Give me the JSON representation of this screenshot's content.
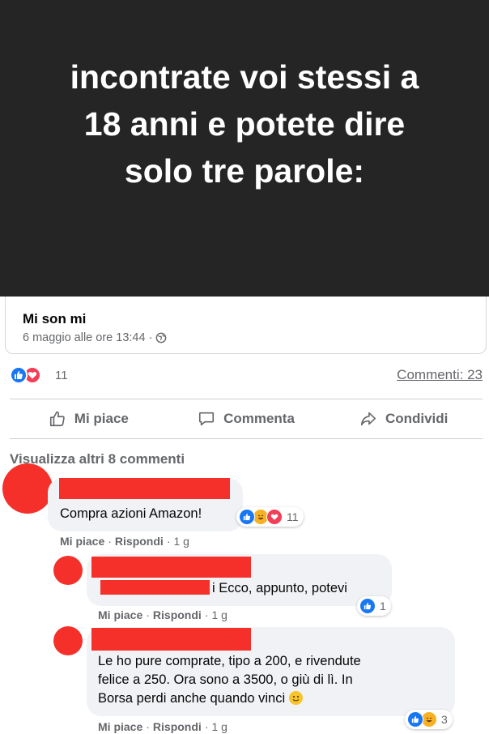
{
  "post": {
    "image_text": [
      "incontrate voi stessi a",
      "18 anni e potete dire",
      "solo tre parole:"
    ],
    "author": "Mi son mi",
    "timestamp": "6 maggio alle ore 13:44 ·",
    "privacy_icon": "globe-icon",
    "reactions": {
      "icons": [
        "like",
        "love"
      ],
      "count": "11"
    },
    "comments_link": "Commenti: 23"
  },
  "actions": {
    "like": "Mi piace",
    "comment": "Commenta",
    "share": "Condividi"
  },
  "more_comments": "Visualizza altri 8 commenti",
  "comments": [
    {
      "text": "Compra azioni Amazon!",
      "reactions": {
        "icons": [
          "like",
          "haha",
          "love"
        ],
        "count": "11"
      },
      "like_label": "Mi piace",
      "reply_label": "Rispondi",
      "time": "1 g"
    },
    {
      "text": "i Ecco, appunto, potevi",
      "reactions": {
        "icons": [
          "like"
        ],
        "count": "1"
      },
      "like_label": "Mi piace",
      "reply_label": "Rispondi",
      "time": "1 g"
    },
    {
      "text_lines": [
        "Le ho pure comprate, tipo a 200, e rivendute",
        "felice a 250. Ora sono a 3500, o giù di lì. In",
        "Borsa perdi anche quando vinci"
      ],
      "reactions": {
        "icons": [
          "like",
          "haha"
        ],
        "count": "3"
      },
      "like_label": "Mi piace",
      "reply_label": "Rispondi",
      "time": "1 g"
    }
  ],
  "colors": {
    "hero_bg": "#252525",
    "redaction": "#f5302a",
    "like_blue": "#1877f2",
    "love_red": "#f33e58",
    "haha_yellow": "#f7b125"
  }
}
